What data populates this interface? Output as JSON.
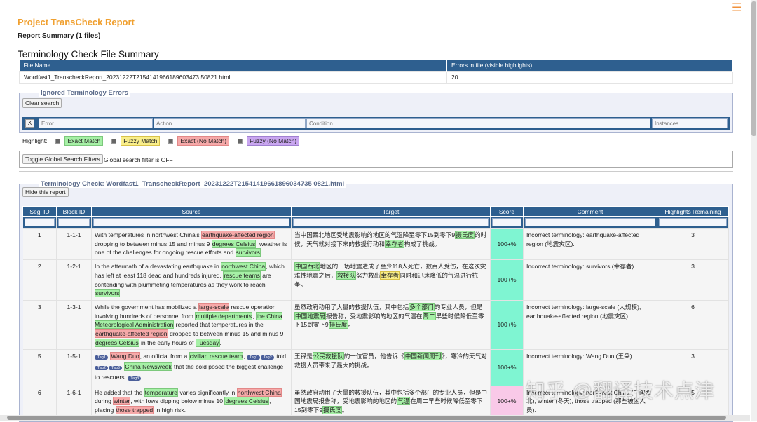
{
  "title": "Project TransCheck Report",
  "subtitle": "Report Summary (1 files)",
  "file_summary": {
    "heading": "Terminology Check File Summary",
    "col_file": "File Name",
    "col_errors": "Errors in file (visible highlights)",
    "file": "Wordfast1_TranscheckReport_20231222T2154141966189603473 50821.html",
    "errors": "20"
  },
  "ignored": {
    "legend": "Ignored Terminology Errors",
    "clear": "Clear search",
    "x": "X",
    "placeholders": {
      "error": "Error",
      "action": "Action",
      "condition": "Condition",
      "instances": "Instances"
    }
  },
  "highlight": {
    "label": "Highlight:",
    "exact": "Exact Match",
    "fuzzy": "Fuzzy Match",
    "exact_no": "Exact (No Match)",
    "fuzzy_no": "Fuzzy (No Match)"
  },
  "global": {
    "toggle": "Toggle Global Search Filters",
    "status": "Global search filter is OFF"
  },
  "check": {
    "legend": "Terminology Check: Wordfast1_TranscheckReport_20231222T21541419661896034735 0821.html",
    "hide": "Hide this report",
    "columns": [
      "Seg. ID",
      "Block ID",
      "Source",
      "Target",
      "Score",
      "Comment",
      "Highlights Remaining"
    ],
    "rows": [
      {
        "seg": "1",
        "block": "1-1-1",
        "score": "100+%",
        "score_color": "#7ff5d2",
        "comment": "Incorrect terminology: earthquake-affected region (地震灾区).",
        "remaining": "3",
        "source": [
          [
            "With temperatures in northwest China's ",
            ""
          ],
          [
            "earthquake-affected region",
            "r"
          ],
          [
            " dropping to between minus 15 and minus 9 ",
            ""
          ],
          [
            "degrees Celsius",
            "g"
          ],
          [
            ", weather is one of the challenges for ongoing rescue efforts and ",
            ""
          ],
          [
            "survivors",
            "g"
          ],
          [
            ".",
            ""
          ]
        ],
        "target": [
          [
            "当中国西北地区受地震影响的地区的气温降至零下15到零下9",
            ""
          ],
          [
            "摄氏度",
            "g"
          ],
          [
            "的时候，天气就对接下来的救援行动和",
            ""
          ],
          [
            "幸存者",
            "g"
          ],
          [
            "构成了挑战。",
            ""
          ]
        ]
      },
      {
        "seg": "2",
        "block": "1-2-1",
        "score": "100+%",
        "score_color": "#7ff5d2",
        "comment": "Incorrect terminology: survivors (幸存者).",
        "remaining": "3",
        "source": [
          [
            "In the aftermath of a devastating earthquake in ",
            ""
          ],
          [
            "northwest China",
            "g"
          ],
          [
            ", which has left at least 118 dead and hundreds injured, ",
            ""
          ],
          [
            "rescue teams",
            "g"
          ],
          [
            " are contending with plummeting temperatures as they work to reach ",
            ""
          ],
          [
            "survivors",
            "g"
          ],
          [
            ".",
            ""
          ]
        ],
        "target": [
          [
            "中国西北",
            "g"
          ],
          [
            "地区的一场地震造成了至少118人死亡，数百人受伤，在这次灾难性地震之后，",
            ""
          ],
          [
            "救援队",
            "g"
          ],
          [
            "努力救出",
            ""
          ],
          [
            "幸存者",
            "y"
          ],
          [
            "同时和迅速降低的气温进行抗争。",
            ""
          ]
        ]
      },
      {
        "seg": "3",
        "block": "1-3-1",
        "score": "100+%",
        "score_color": "#7ff5d2",
        "comment": "Incorrect terminology: large-scale (大规模), earthquake-affected region (地震灾区).",
        "remaining": "6",
        "source": [
          [
            "While the government has mobilized a ",
            ""
          ],
          [
            "large-scale",
            "r"
          ],
          [
            " rescue operation involving hundreds of personnel from ",
            ""
          ],
          [
            "multiple departments",
            "g"
          ],
          [
            ", ",
            ""
          ],
          [
            "the China Meteorological Administration",
            "g"
          ],
          [
            " reported that temperatures in the ",
            ""
          ],
          [
            "earthquake-affected region",
            "r"
          ],
          [
            " dropped to between minus 15 and minus 9 ",
            ""
          ],
          [
            "degrees Celsius",
            "g"
          ],
          [
            " in the early hours of ",
            ""
          ],
          [
            "Tuesday",
            "g"
          ],
          [
            ".",
            ""
          ]
        ],
        "target": [
          [
            "虽然政府动用了大量的救援队伍，其中包括",
            ""
          ],
          [
            "多个部门",
            "g"
          ],
          [
            "的专业人员，但是",
            ""
          ],
          [
            "中国地震局",
            "g"
          ],
          [
            "报告称，受地震影响的地区的气温在",
            ""
          ],
          [
            "周二",
            "g"
          ],
          [
            "早些时候降低至零下15到零下9",
            ""
          ],
          [
            "摄氏度",
            "g"
          ],
          [
            "。",
            ""
          ]
        ]
      },
      {
        "seg": "5",
        "block": "1-5-1",
        "score": "100+%",
        "score_color": "#7ff5d2",
        "comment": "Incorrect terminology: Wang Duo (王朵).",
        "remaining": "3",
        "source": [
          [
            "Tag1",
            "tag"
          ],
          [
            " ",
            ""
          ],
          [
            "Wang Duo",
            "r"
          ],
          [
            ", an official from a ",
            ""
          ],
          [
            "civilian rescue team",
            "g"
          ],
          [
            ", ",
            ""
          ],
          [
            "Tag1",
            "tag"
          ],
          [
            "Tag2",
            "tag"
          ],
          [
            " told ",
            ""
          ],
          [
            "Tag2",
            "tag"
          ],
          [
            "Tag3",
            "tag"
          ],
          [
            " ",
            ""
          ],
          [
            "China Newsweek",
            "g"
          ],
          [
            " that the cold posed the biggest challenge to rescuers. ",
            ""
          ],
          [
            "Tag3",
            "tag"
          ]
        ],
        "target": [
          [
            "王铎是",
            ""
          ],
          [
            "公民救援队",
            "g"
          ],
          [
            "的一位官员，他告诉《",
            ""
          ],
          [
            "中国新闻周刊",
            "g"
          ],
          [
            "》，寒冷的天气对救援人员带来了最大的挑战。",
            ""
          ]
        ]
      },
      {
        "seg": "6",
        "block": "1-6-1",
        "score": "100+%",
        "score_color": "#f9c9e8",
        "comment": "Incorrect terminology: northwest China (中国西北), winter (冬天), those trapped (那些被困人员).",
        "remaining": "5",
        "source": [
          [
            "He added that the ",
            ""
          ],
          [
            "temperature",
            "g"
          ],
          [
            " varies significantly in ",
            ""
          ],
          [
            "northwest China",
            "r"
          ],
          [
            " during ",
            ""
          ],
          [
            "winter",
            "r"
          ],
          [
            ", with lows dipping below minus 10 ",
            ""
          ],
          [
            "degrees Celsius",
            "g"
          ],
          [
            ", placing ",
            ""
          ],
          [
            "those trapped",
            "r"
          ],
          [
            " in high risk.",
            ""
          ]
        ],
        "target": [
          [
            "虽然政府动用了大量的救援队伍，其中包括多个部门的专业人员，但是中国地震局报告称，受地震影响的地区的",
            ""
          ],
          [
            "气温",
            "g"
          ],
          [
            "在周二早些时候降低至零下15到零下9",
            ""
          ],
          [
            "摄氏度",
            "g"
          ],
          [
            "。",
            ""
          ]
        ]
      }
    ]
  },
  "watermark": "知乎 @翻译技术点津",
  "colors": {
    "brand": "#f0a030",
    "header": "#2e5f8f",
    "exact": "#a6f0a6",
    "fuzzy": "#f9ee8a",
    "exact_no": "#f6a9a9",
    "fuzzy_no": "#c9a6f0"
  }
}
